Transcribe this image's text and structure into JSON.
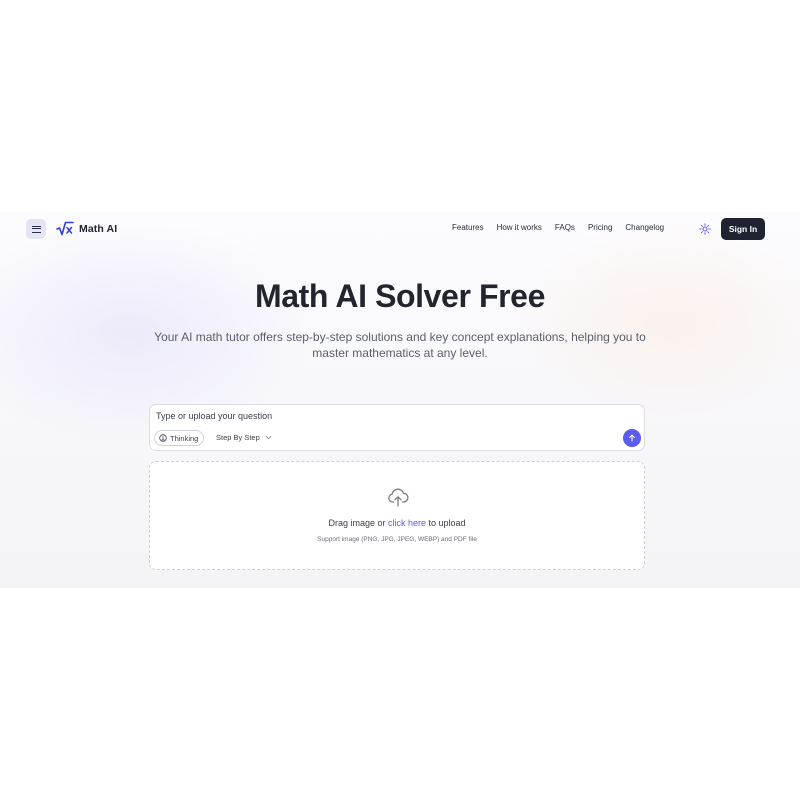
{
  "header": {
    "brand": "Math AI",
    "nav": [
      "Features",
      "How it works",
      "FAQs",
      "Pricing",
      "Changelog"
    ],
    "signin_label": "Sign In"
  },
  "hero": {
    "title": "Math AI Solver Free",
    "subtitle": "Your AI math tutor offers step-by-step solutions and key concept explanations, helping you to master mathematics at any level."
  },
  "question": {
    "placeholder": "Type or upload your question",
    "thinking_label": "Thinking",
    "mode_label": "Step By Step"
  },
  "upload": {
    "text_before": "Drag image or ",
    "link_text": "click here",
    "text_after": " to upload",
    "hint": "Support image (PNG, JPG, JPEG, WEBP) and PDF file"
  },
  "colors": {
    "accent": "#5b5cf0",
    "dark_button": "#1f2230",
    "menu_bg": "#e4e5f4"
  },
  "icons": [
    "menu-icon",
    "sqrt-x-logo-icon",
    "sun-icon",
    "lightbulb-icon",
    "chevron-down-icon",
    "arrow-up-icon",
    "cloud-upload-icon"
  ]
}
